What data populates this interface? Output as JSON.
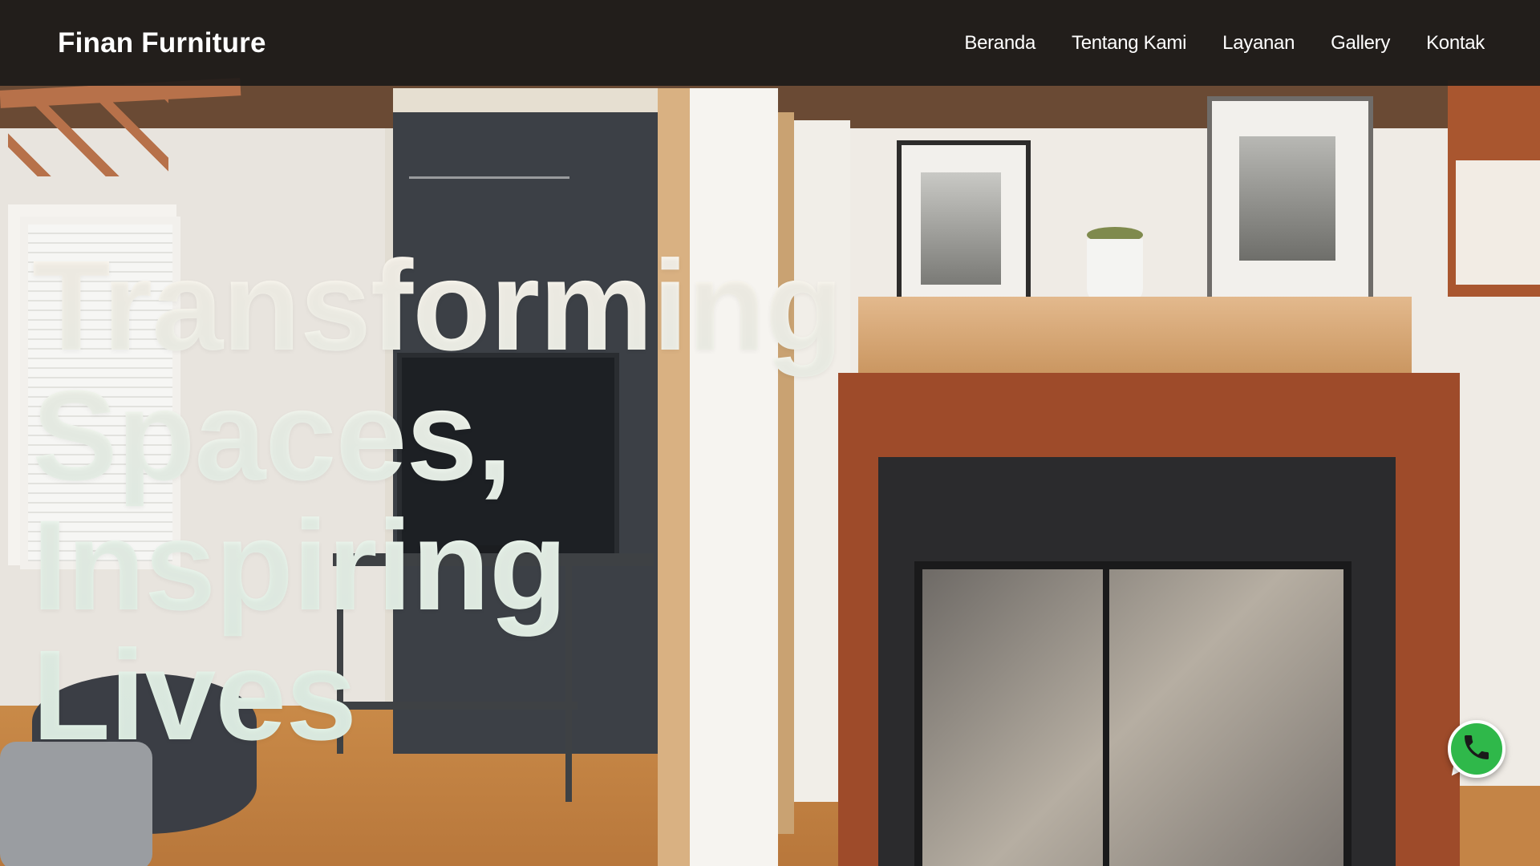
{
  "header": {
    "brand": "Finan Furniture",
    "nav": [
      {
        "label": "Beranda"
      },
      {
        "label": "Tentang Kami"
      },
      {
        "label": "Layanan"
      },
      {
        "label": "Gallery"
      },
      {
        "label": "Kontak"
      }
    ]
  },
  "hero": {
    "title_lines": [
      "Transforming",
      "Spaces, Inspiring",
      "Lives"
    ]
  },
  "chat": {
    "icon": "whatsapp-phone-icon",
    "color": "#2fb84a"
  }
}
